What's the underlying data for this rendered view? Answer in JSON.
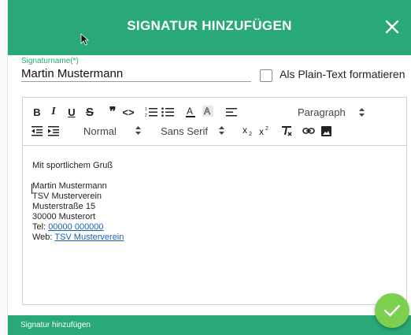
{
  "dialog": {
    "title": "SIGNATUR HINZUFÜGEN",
    "close_icon": "close-icon",
    "footer_text": "Signatur hinzufügen",
    "confirm_icon": "check-icon"
  },
  "form": {
    "name_label": "Signaturname(*)",
    "name_value": "Martin Mustermann",
    "plain_text_label": "Als Plain-Text formatieren",
    "plain_text_checked": false
  },
  "toolbar": {
    "row1": [
      "bold-icon",
      "italic-icon",
      "underline-icon",
      "strikethrough-icon",
      "blockquote-icon",
      "code-icon",
      "ordered-list-icon",
      "bullet-list-icon",
      "font-color-icon",
      "background-color-icon",
      "align-icon"
    ],
    "paragraph_select": "Paragraph",
    "size_select": "Normal",
    "font_select": "Sans Serif",
    "row2": [
      "outdent-icon",
      "indent-icon",
      "subscript-icon",
      "superscript-icon",
      "clear-format-icon",
      "link-icon",
      "image-icon"
    ]
  },
  "editor": {
    "greeting": "Mit sportlichem Gruß",
    "lines": [
      "Martin Mustermann",
      "TSV Musterverein",
      "Musterstraße 15",
      "30000 Musterort"
    ],
    "tel_label": "Tel:",
    "tel_value": "00000 000000",
    "web_label": "Web:",
    "web_value": "TSV Musterverein"
  },
  "colors": {
    "brand_green": "#28a977",
    "confirm_green": "#7ccf4f",
    "link_blue": "#1a5fb4"
  }
}
